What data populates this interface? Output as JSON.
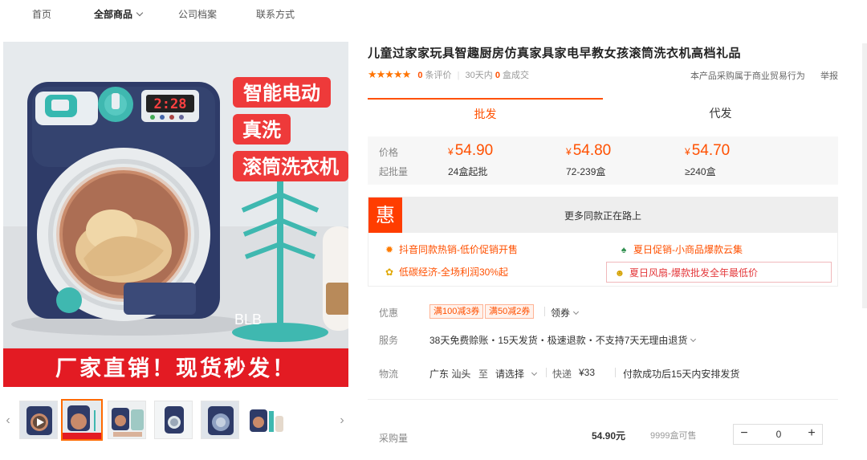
{
  "nav": {
    "home": "首页",
    "all_products": "全部商品",
    "company_profile": "公司档案",
    "contact": "联系方式"
  },
  "gallery": {
    "image_texts": {
      "line1": "智能电动",
      "line2": "真洗",
      "line3": "滚筒洗衣机",
      "banner": "厂家直销！现货秒发！",
      "watermark": "BLB",
      "display": "2:28"
    }
  },
  "product": {
    "title": "儿童过家家玩具智趣厨房仿真家具家电早教女孩滚筒洗衣机高档礼品",
    "rating_stars": 5,
    "review_count": "0",
    "review_label": "条评价",
    "sales_prefix": "30天内",
    "sales_count": "0",
    "sales_suffix": "盒成交",
    "trade_note": "本产品采购属于商业贸易行为",
    "report": "举报"
  },
  "tabs": {
    "wholesale": "批发",
    "dropship": "代发"
  },
  "pricing": {
    "price_label": "价格",
    "moq_label": "起批量",
    "currency": "¥",
    "tiers": [
      {
        "price": "54.90",
        "qty": "24盒起批"
      },
      {
        "price": "54.80",
        "qty": "72-239盒"
      },
      {
        "price": "54.70",
        "qty": "≥240盒"
      }
    ]
  },
  "promo": {
    "badge": "惠",
    "header": "更多同款正在路上",
    "items": [
      {
        "icon": "flame-icon",
        "text": "抖音同款热销-低价促销开售"
      },
      {
        "icon": "leaf-icon",
        "text": "夏日促销-小商品爆款云集"
      },
      {
        "icon": "sunflower-icon",
        "text": "低碳经济-全场利润30%起"
      },
      {
        "icon": "frog-icon",
        "text": "夏日风扇-爆款批发全年最低价"
      }
    ]
  },
  "discount": {
    "label": "优惠",
    "coupons": [
      "满100减3券",
      "满50减2券"
    ],
    "claim": "领券"
  },
  "service": {
    "label": "服务",
    "text": "38天免费赊账・15天发货・极速退款・不支持7天无理由退货"
  },
  "logistics": {
    "label": "物流",
    "origin": "广东 汕头",
    "to": "至",
    "destination": "请选择",
    "express": "快递",
    "fee": "¥33",
    "dispatch": "付款成功后15天内安排发货"
  },
  "purchase": {
    "label": "采购量",
    "unit_price": "54.90元",
    "stock": "9999盒可售",
    "quantity": "0",
    "minus": "−",
    "plus": "+"
  },
  "colors": {
    "accent": "#ff5000",
    "badge_red": "#ff3d00",
    "promo_red": "#e4393c"
  }
}
